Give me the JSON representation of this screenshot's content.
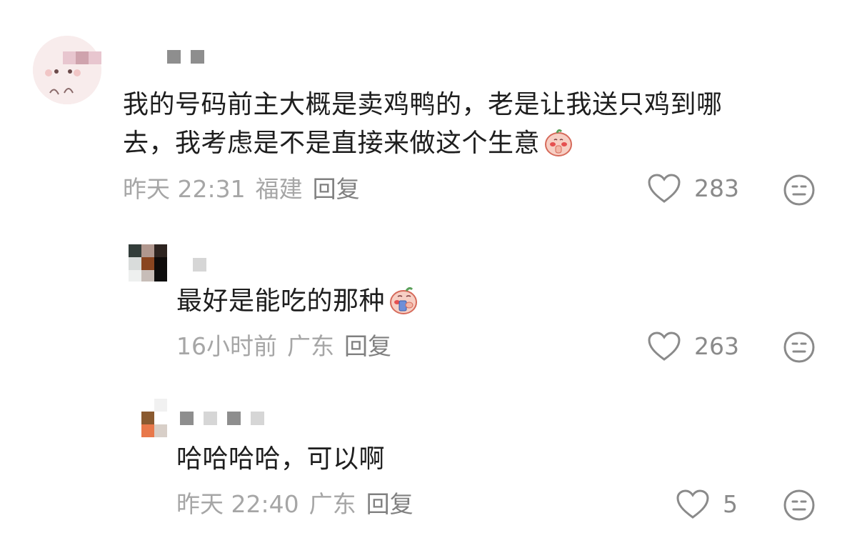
{
  "comments": [
    {
      "text_line1": "我的号码前主大概是卖鸡鸭的，老是让我送只鸡到哪",
      "text_line2": "去，我考虑是不是直接来做这个生意",
      "time": "昨天 22:31",
      "location": "福建",
      "reply_label": "回复",
      "likes": "283",
      "emoji": "peach-pray-emoji"
    },
    {
      "text": "最好是能吃的那种",
      "time": "16小时前",
      "location": "广东",
      "reply_label": "回复",
      "likes": "263",
      "emoji": "peach-eating-emoji"
    },
    {
      "text": "哈哈哈哈，可以啊",
      "time": "昨天 22:40",
      "location": "广东",
      "reply_label": "回复",
      "likes": "5"
    }
  ],
  "colors": {
    "text": "#1e1e1e",
    "meta": "#a6a6a6",
    "icon": "#8a8a8a"
  }
}
